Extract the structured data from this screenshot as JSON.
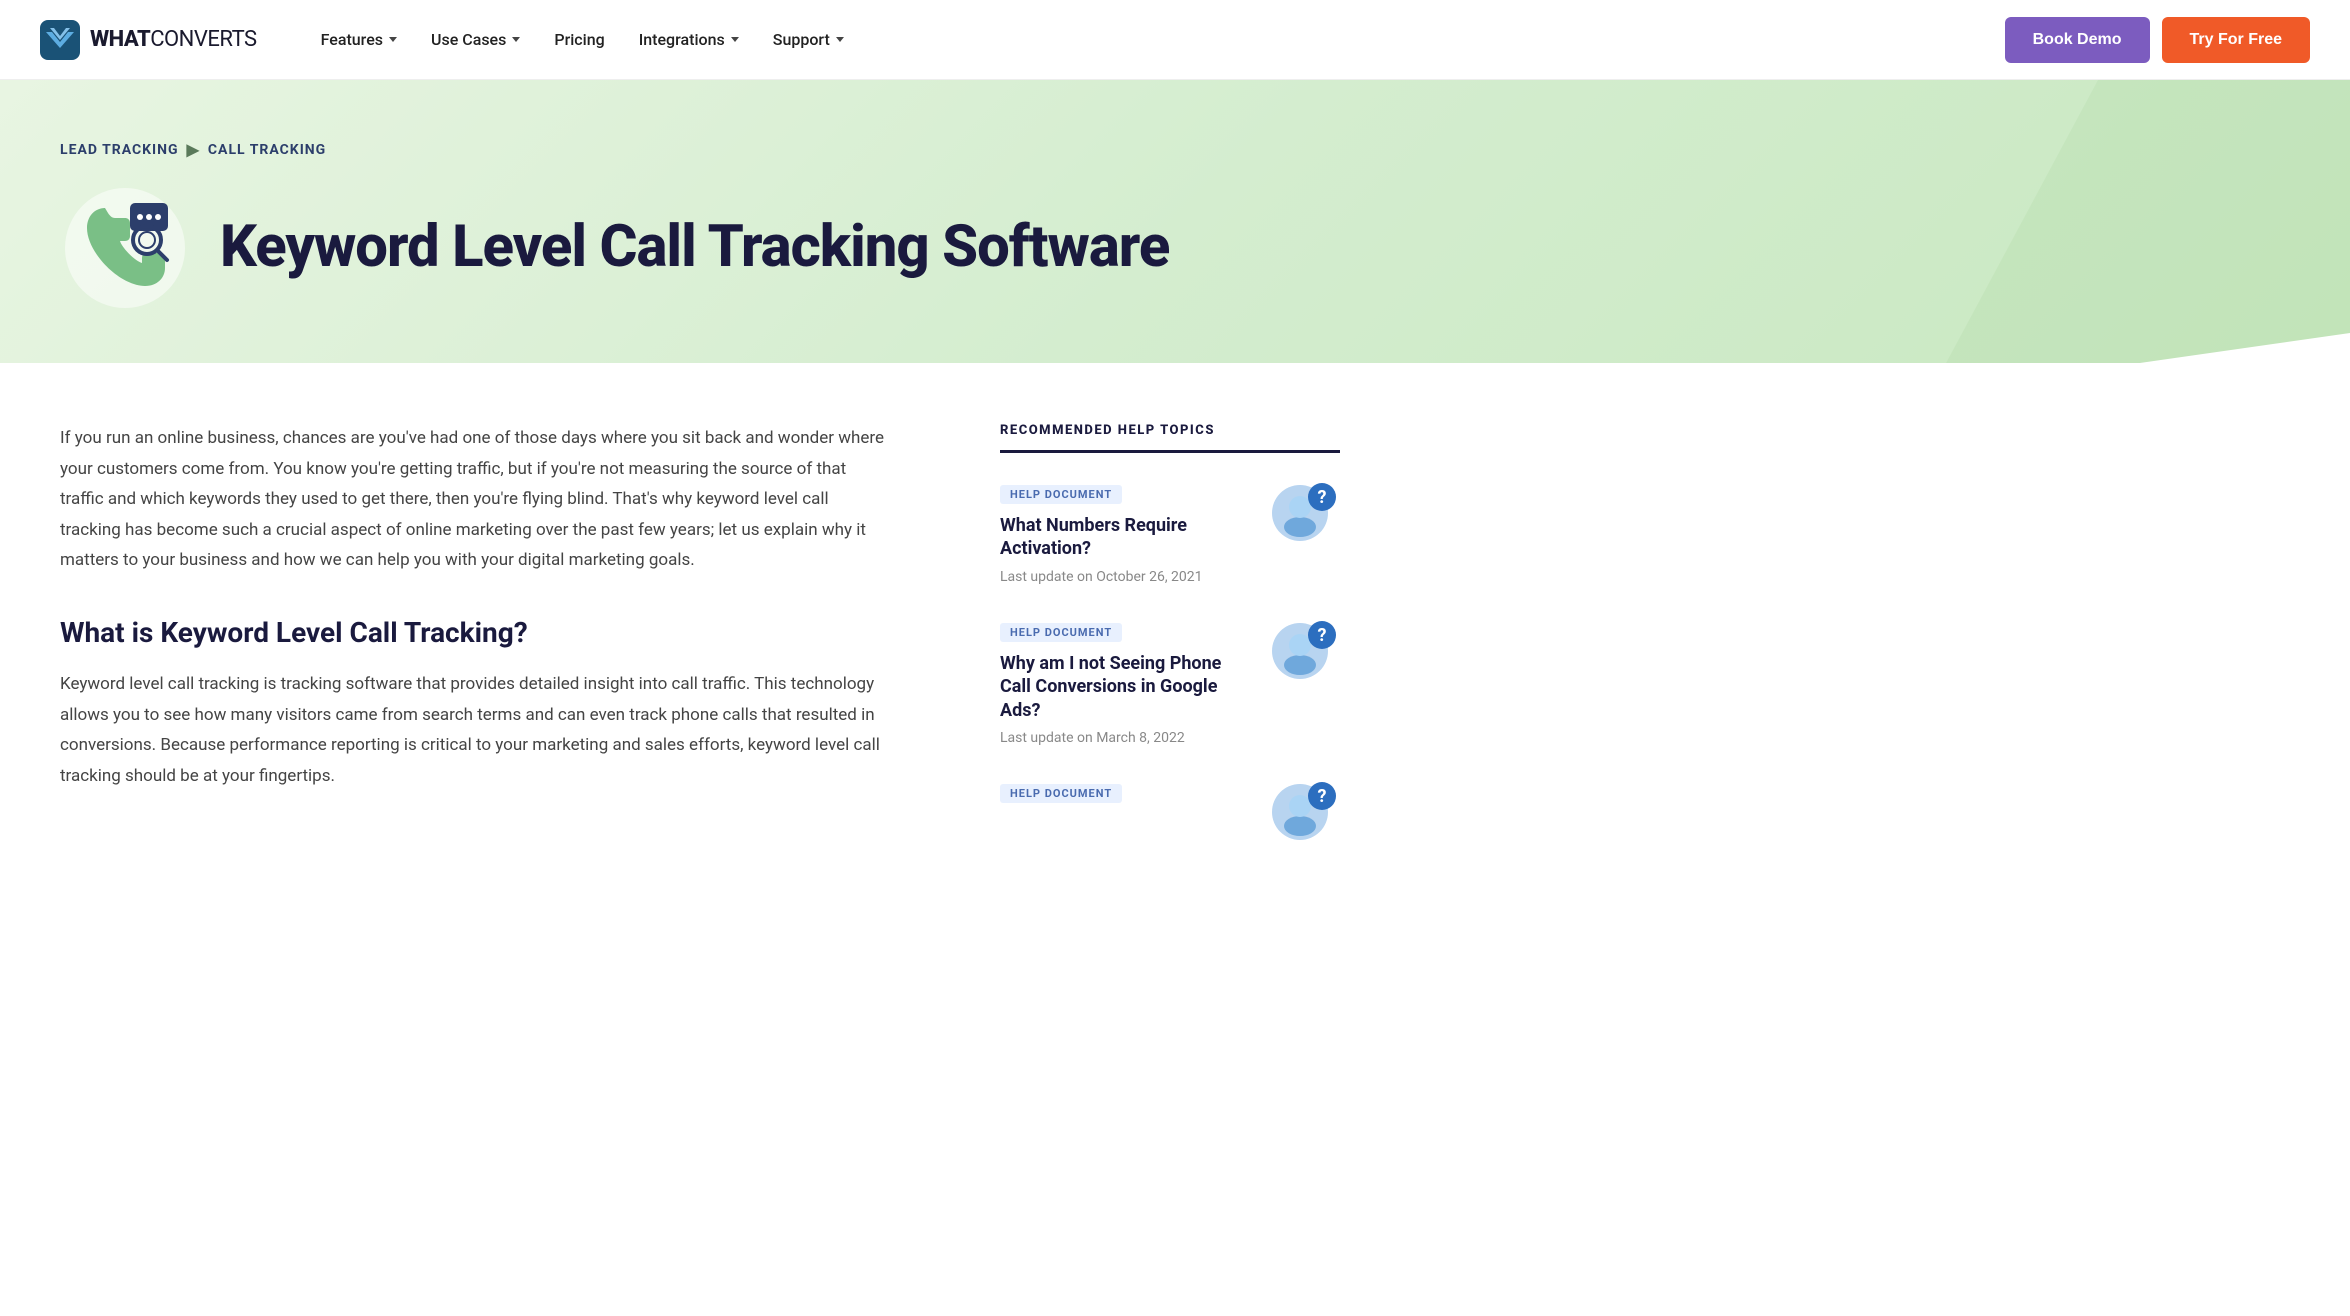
{
  "nav": {
    "logo_bold": "WHAT",
    "logo_regular": "CONVERTS",
    "items": [
      {
        "label": "Features",
        "has_dropdown": true
      },
      {
        "label": "Use Cases",
        "has_dropdown": true
      },
      {
        "label": "Pricing",
        "has_dropdown": false
      },
      {
        "label": "Integrations",
        "has_dropdown": true
      },
      {
        "label": "Support",
        "has_dropdown": true
      }
    ],
    "btn_book": "Book Demo",
    "btn_try": "Try For Free"
  },
  "hero": {
    "breadcrumb_parent": "LEAD TRACKING",
    "breadcrumb_child": "CALL TRACKING",
    "title": "Keyword Level Call Tracking Software"
  },
  "main": {
    "intro": "If you run an online business, chances are you've had one of those days where you sit back and wonder where your customers come from. You know you're getting traffic, but if you're not measuring the source of that traffic and which keywords they used to get there, then you're flying blind. That's why keyword level call tracking has become such a crucial aspect of online marketing over the past few years; let us explain why it matters to your business and how we can help you with your digital marketing goals.",
    "section1_title": "What is Keyword Level Call Tracking?",
    "section1_body": "Keyword level call tracking is tracking software that provides detailed insight into call traffic. This technology allows you to see how many visitors came from search terms and can even track phone calls that resulted in conversions. Because performance reporting is critical to your marketing and sales efforts, keyword level call tracking should be at your fingertips."
  },
  "sidebar": {
    "section_title": "RECOMMENDED HELP TOPICS",
    "cards": [
      {
        "badge": "HELP DOCUMENT",
        "title": "What Numbers Require Activation?",
        "date": "Last update on October 26, 2021"
      },
      {
        "badge": "HELP DOCUMENT",
        "title": "Why am I not Seeing Phone Call Conversions in Google Ads?",
        "date": "Last update on March 8, 2022"
      },
      {
        "badge": "HELP DOCUMENT",
        "title": "",
        "date": ""
      }
    ]
  }
}
